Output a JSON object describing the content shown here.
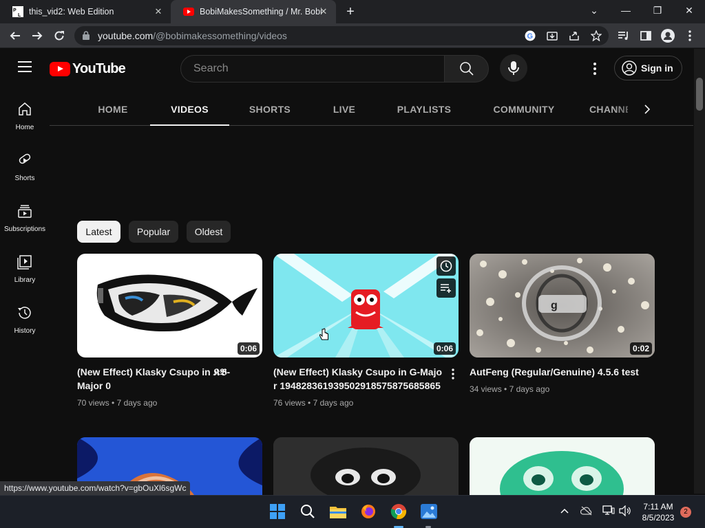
{
  "browser": {
    "tabs": [
      {
        "title": "this_vid2: Web Edition",
        "favicon": "pl-favicon"
      },
      {
        "title": "BobiMakesSomething / Mr. Bobi",
        "favicon": "youtube-favicon",
        "active": true
      }
    ],
    "url_host": "youtube.com",
    "url_path": "/@bobimakessomething/videos"
  },
  "youtube": {
    "logo_text": "YouTube",
    "search_placeholder": "Search",
    "sign_in": "Sign in",
    "sidenav": [
      {
        "label": "Home",
        "icon": "home-icon"
      },
      {
        "label": "Shorts",
        "icon": "shorts-icon"
      },
      {
        "label": "Subscriptions",
        "icon": "subscriptions-icon"
      },
      {
        "label": "Library",
        "icon": "library-icon"
      },
      {
        "label": "History",
        "icon": "history-icon"
      }
    ],
    "channel_tabs": [
      "HOME",
      "VIDEOS",
      "SHORTS",
      "LIVE",
      "PLAYLISTS",
      "COMMUNITY",
      "CHANNELS"
    ],
    "active_tab": "VIDEOS",
    "sort_chips": [
      "Latest",
      "Popular",
      "Oldest"
    ],
    "active_chip": "Latest",
    "videos": [
      {
        "title": "(New Effect) Klasky Csupo in 𝕶𝕭-Major 0",
        "views": "70 views",
        "age": "7 days ago",
        "duration": "0:06"
      },
      {
        "title": "(New Effect) Klasky Csupo in G-Major 1948283619395029185758756858656",
        "views": "76 views",
        "age": "7 days ago",
        "duration": "0:06"
      },
      {
        "title": "AutFeng (Regular/Genuine) 4.5.6 test",
        "views": "34 views",
        "age": "7 days ago",
        "duration": "0:02"
      }
    ],
    "meta_separator": "•"
  },
  "status_url": "https://www.youtube.com/watch?v=gbOuXl6sgWc",
  "taskbar": {
    "time": "7:11 AM",
    "date": "8/5/2023",
    "notifications": "2"
  },
  "colors": {
    "yt_red": "#ff0000",
    "background": "#0f0f0f",
    "chrome_dark": "#202124"
  }
}
